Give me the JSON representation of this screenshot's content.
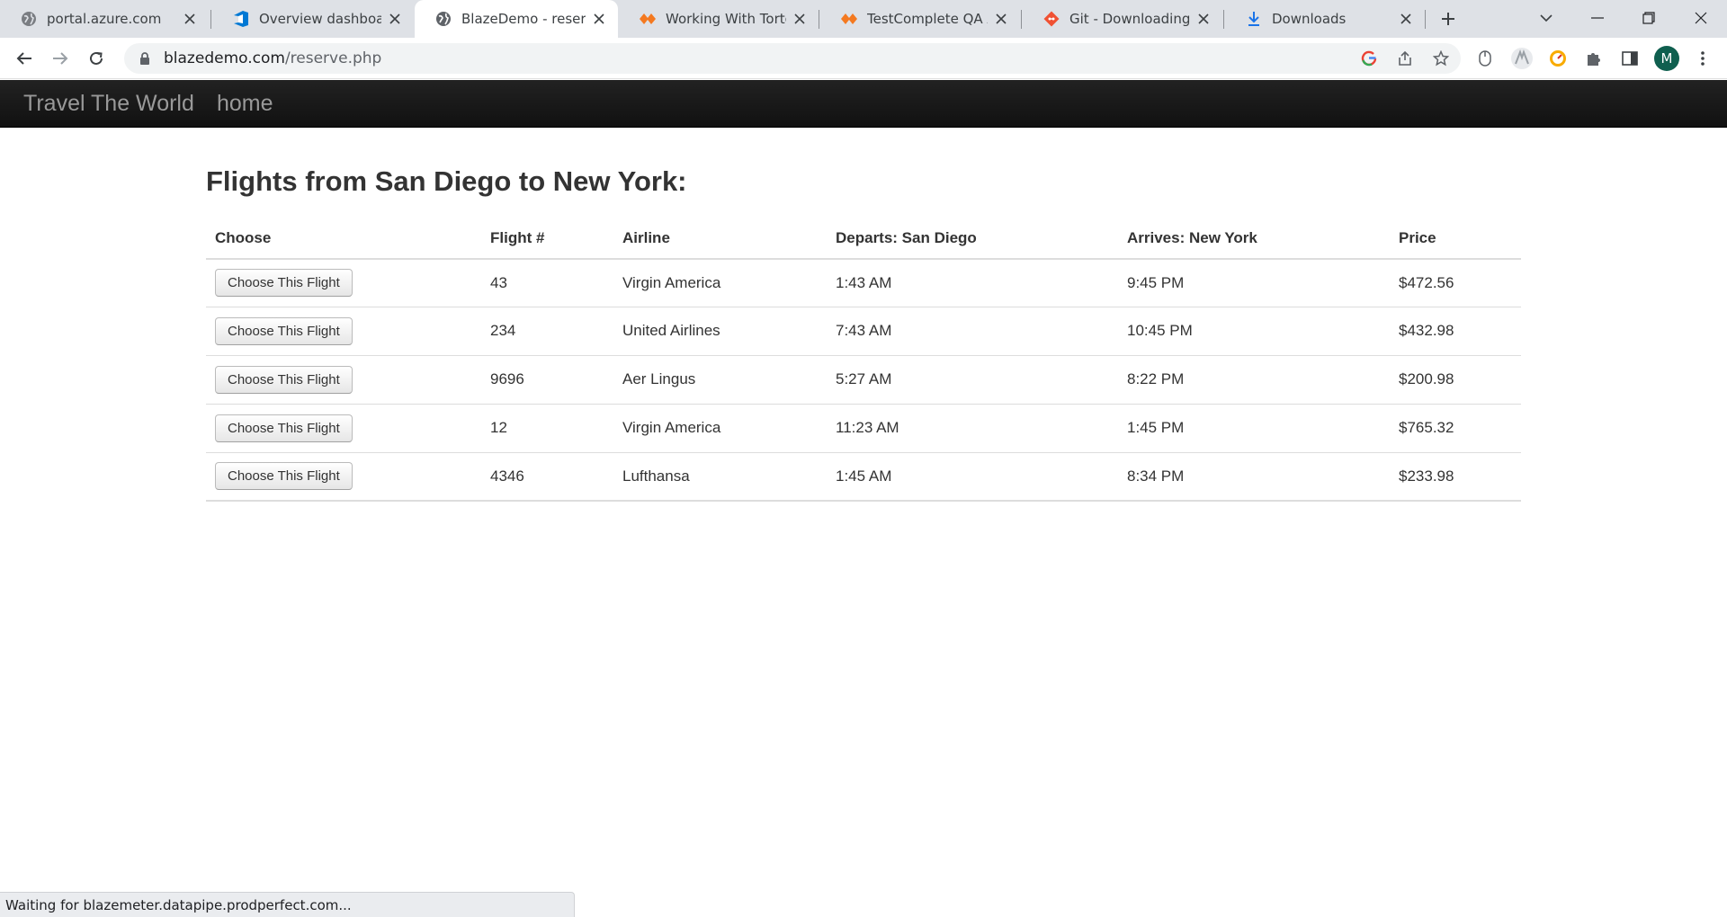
{
  "browser": {
    "tabs": [
      {
        "title": "portal.azure.com",
        "icon": "globe-icon"
      },
      {
        "title": "Overview dashboard - ",
        "icon": "azure-devops-icon"
      },
      {
        "title": "BlazeDemo - reserve",
        "icon": "globe-icon",
        "active": true
      },
      {
        "title": "Working With Tortoise",
        "icon": "smartbear-icon"
      },
      {
        "title": "TestComplete QA Arch",
        "icon": "smartbear-icon"
      },
      {
        "title": "Git - Downloading Pa",
        "icon": "git-icon"
      },
      {
        "title": "Downloads",
        "icon": "download-icon"
      }
    ],
    "url_host": "blazedemo.com",
    "url_path": "/reserve.php",
    "profile_initial": "M",
    "colors": {
      "tabstrip": "#dee1e6",
      "git": "#f05133",
      "smartbear": "#f47920",
      "azure": "#0078d4",
      "avatar": "#0f5f4f"
    }
  },
  "site": {
    "brand": "Travel The World",
    "nav_home": "home"
  },
  "page": {
    "heading": "Flights from San Diego to New York:",
    "columns": [
      "Choose",
      "Flight #",
      "Airline",
      "Departs: San Diego",
      "Arrives: New York",
      "Price"
    ],
    "choose_label": "Choose This Flight",
    "flights": [
      {
        "number": "43",
        "airline": "Virgin America",
        "departs": "1:43 AM",
        "arrives": "9:45 PM",
        "price": "$472.56"
      },
      {
        "number": "234",
        "airline": "United Airlines",
        "departs": "7:43 AM",
        "arrives": "10:45 PM",
        "price": "$432.98"
      },
      {
        "number": "9696",
        "airline": "Aer Lingus",
        "departs": "5:27 AM",
        "arrives": "8:22 PM",
        "price": "$200.98"
      },
      {
        "number": "12",
        "airline": "Virgin America",
        "departs": "11:23 AM",
        "arrives": "1:45 PM",
        "price": "$765.32"
      },
      {
        "number": "4346",
        "airline": "Lufthansa",
        "departs": "1:45 AM",
        "arrives": "8:34 PM",
        "price": "$233.98"
      }
    ]
  },
  "status": {
    "text": "Waiting for blazemeter.datapipe.prodperfect.com..."
  }
}
